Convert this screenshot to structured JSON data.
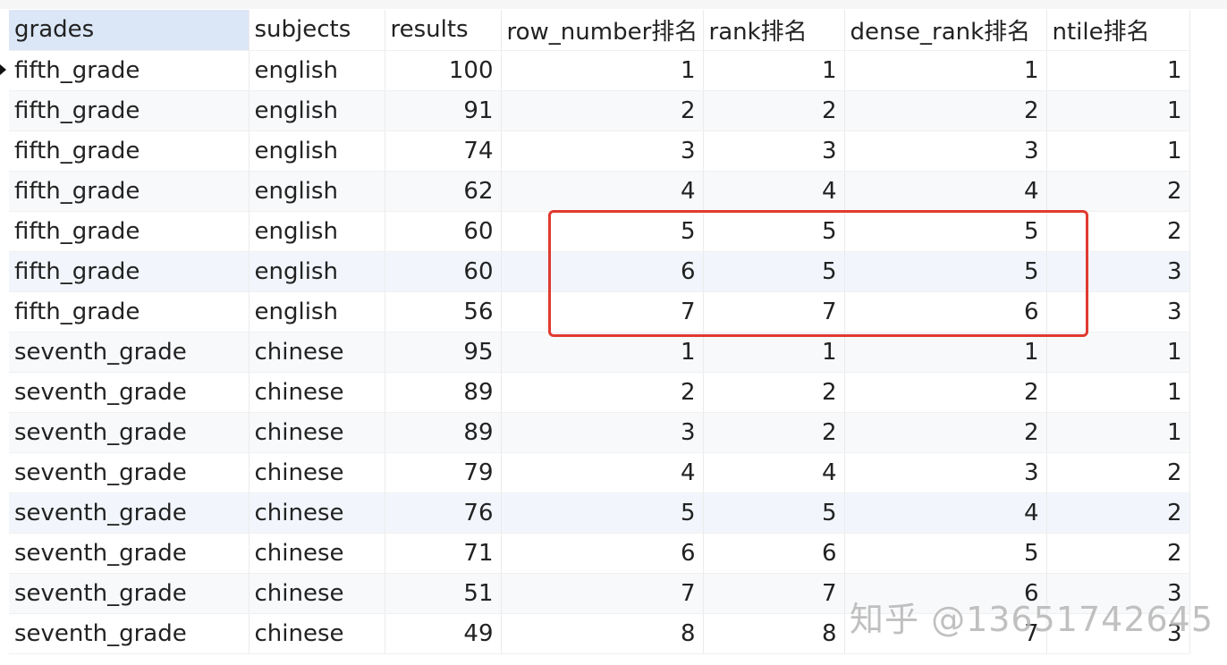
{
  "columns": [
    "grades",
    "subjects",
    "results",
    "row_number排名",
    "rank排名",
    "dense_rank排名",
    "ntile排名"
  ],
  "rows": [
    [
      "fifth_grade",
      "english",
      "100",
      "1",
      "1",
      "1",
      "1"
    ],
    [
      "fifth_grade",
      "english",
      "91",
      "2",
      "2",
      "2",
      "1"
    ],
    [
      "fifth_grade",
      "english",
      "74",
      "3",
      "3",
      "3",
      "1"
    ],
    [
      "fifth_grade",
      "english",
      "62",
      "4",
      "4",
      "4",
      "2"
    ],
    [
      "fifth_grade",
      "english",
      "60",
      "5",
      "5",
      "5",
      "2"
    ],
    [
      "fifth_grade",
      "english",
      "60",
      "6",
      "5",
      "5",
      "3"
    ],
    [
      "fifth_grade",
      "english",
      "56",
      "7",
      "7",
      "6",
      "3"
    ],
    [
      "seventh_grade",
      "chinese",
      "95",
      "1",
      "1",
      "1",
      "1"
    ],
    [
      "seventh_grade",
      "chinese",
      "89",
      "2",
      "2",
      "2",
      "1"
    ],
    [
      "seventh_grade",
      "chinese",
      "89",
      "3",
      "2",
      "2",
      "1"
    ],
    [
      "seventh_grade",
      "chinese",
      "79",
      "4",
      "4",
      "3",
      "2"
    ],
    [
      "seventh_grade",
      "chinese",
      "76",
      "5",
      "5",
      "4",
      "2"
    ],
    [
      "seventh_grade",
      "chinese",
      "71",
      "6",
      "6",
      "5",
      "2"
    ],
    [
      "seventh_grade",
      "chinese",
      "51",
      "7",
      "7",
      "6",
      "3"
    ],
    [
      "seventh_grade",
      "chinese",
      "49",
      "8",
      "8",
      "7",
      "3"
    ]
  ],
  "watermark": "知乎 @13651742645",
  "colors": {
    "header_highlight": "#dbe7f6",
    "annotation_box": "#e03a30"
  }
}
